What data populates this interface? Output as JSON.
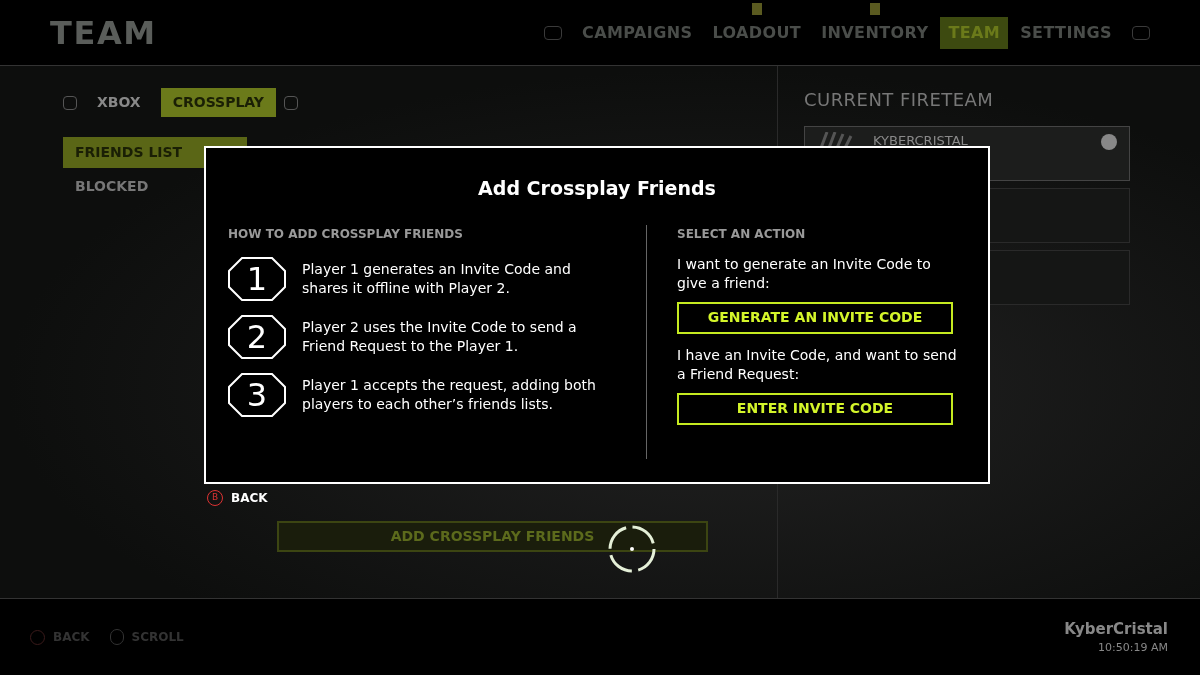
{
  "header": {
    "title": "TEAM",
    "nav": [
      {
        "label": "CAMPAIGNS",
        "selected": false,
        "alert": false
      },
      {
        "label": "LOADOUT",
        "selected": false,
        "alert": true
      },
      {
        "label": "INVENTORY",
        "selected": false,
        "alert": true
      },
      {
        "label": "TEAM",
        "selected": true,
        "alert": false
      },
      {
        "label": "SETTINGS",
        "selected": false,
        "alert": false
      }
    ]
  },
  "platform_tabs": [
    {
      "label": "XBOX",
      "selected": false
    },
    {
      "label": "CROSSPLAY",
      "selected": true
    }
  ],
  "side_menu": [
    {
      "label": "FRIENDS LIST",
      "selected": true
    },
    {
      "label": "BLOCKED",
      "selected": false
    }
  ],
  "fireteam": {
    "title": "CURRENT FIRETEAM",
    "members": [
      {
        "name": "KYBERCRISTAL"
      }
    ]
  },
  "back_prompt": {
    "key": "B",
    "label": "BACK"
  },
  "add_button": "ADD CROSSPLAY FRIENDS",
  "dialog": {
    "title": "Add Crossplay Friends",
    "steps_heading": "HOW TO ADD CROSSPLAY FRIENDS",
    "steps": [
      {
        "number": "1",
        "text": "Player 1 generates an Invite Code and shares it offline with Player 2."
      },
      {
        "number": "2",
        "text": "Player 2 uses the Invite Code to send a Friend Request to the Player 1."
      },
      {
        "number": "3",
        "text": "Player 1 accepts the request, adding both players to each other’s friends lists."
      }
    ],
    "actions_heading": "SELECT AN ACTION",
    "actions": [
      {
        "text": "I want to generate an Invite Code to give a friend:",
        "button": "GENERATE AN INVITE CODE"
      },
      {
        "text": "I have an Invite Code, and want to send a Friend Request:",
        "button": "ENTER INVITE CODE"
      }
    ]
  },
  "footer": {
    "prompts": [
      {
        "kind": "b",
        "label": "BACK"
      },
      {
        "kind": "stick",
        "label": "SCROLL"
      }
    ],
    "user": "KyberCristal",
    "time": "10:50:19 AM"
  }
}
